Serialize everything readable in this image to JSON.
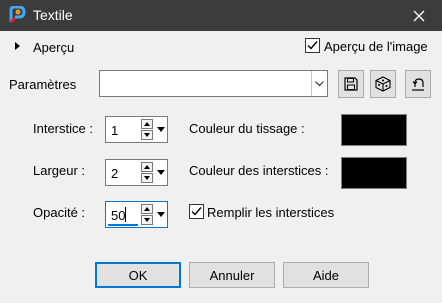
{
  "window": {
    "title": "Textile"
  },
  "preview": {
    "label": "Aperçu",
    "checkbox_label": "Aperçu de l'image",
    "checked": true
  },
  "presets": {
    "label": "Paramètres",
    "value": ""
  },
  "fields": {
    "interstice": {
      "label": "Interstice :",
      "value": "1"
    },
    "largeur": {
      "label": "Largeur :",
      "value": "2"
    },
    "opacite": {
      "label": "Opacité :",
      "value": "50"
    }
  },
  "colors": {
    "tissage": {
      "label": "Couleur du tissage :",
      "color": "#000000"
    },
    "interstices": {
      "label": "Couleur des interstices :",
      "color": "#000000"
    }
  },
  "fill": {
    "label": "Remplir les interstices",
    "checked": true
  },
  "buttons": {
    "ok": "OK",
    "cancel": "Annuler",
    "help": "Aide"
  },
  "accent": "#0078d7"
}
